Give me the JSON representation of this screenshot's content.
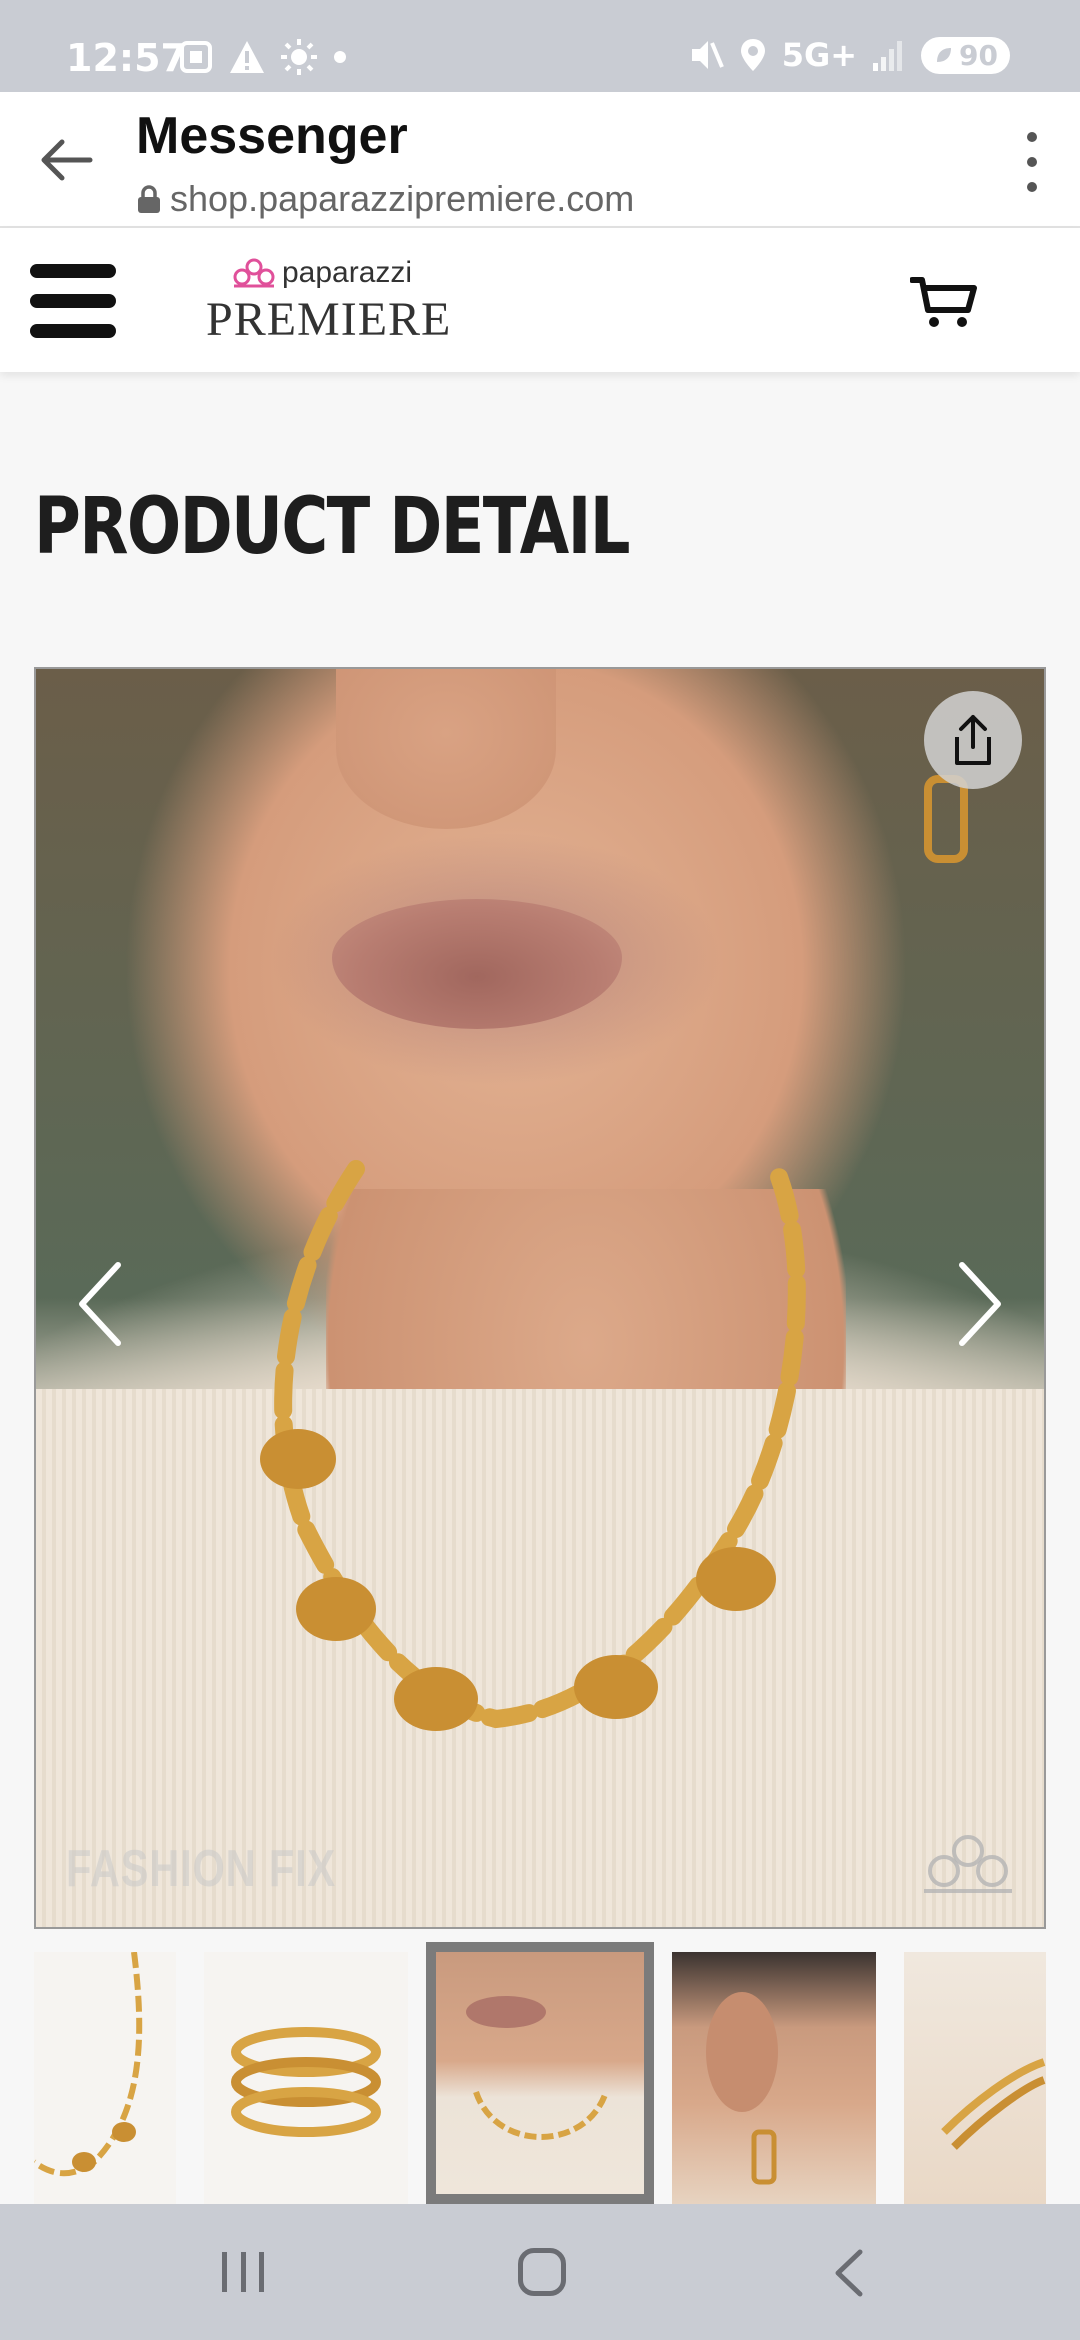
{
  "status_bar": {
    "time": "12:57",
    "network": "5G+",
    "battery": "90",
    "icons_left": [
      "screenshot-icon",
      "warning-icon",
      "brightness-icon",
      "dot-icon"
    ],
    "icons_right": [
      "mute-icon",
      "location-icon",
      "signal-icon",
      "battery-icon"
    ]
  },
  "browser": {
    "title": "Messenger",
    "url": "shop.paparazzipremiere.com"
  },
  "site_header": {
    "logo_top": "paparazzi",
    "logo_bottom": "PREMIERE"
  },
  "page": {
    "heading": "PRODUCT DETAIL"
  },
  "main_image": {
    "watermark_text": "FASHION FIX",
    "alt": "Gold chain necklace with knotted links worn with cream sweater"
  },
  "thumbnails": [
    {
      "name": "necklace-flatlay",
      "selected": false
    },
    {
      "name": "ring",
      "selected": false
    },
    {
      "name": "necklace-model",
      "selected": true
    },
    {
      "name": "earring-model",
      "selected": false
    },
    {
      "name": "bracelet",
      "selected": false
    }
  ],
  "colors": {
    "status_bar_bg": "#c9ccd3",
    "heading": "#1e1e1e",
    "gold": "#d8a444",
    "brand_pink": "#e0509a"
  }
}
